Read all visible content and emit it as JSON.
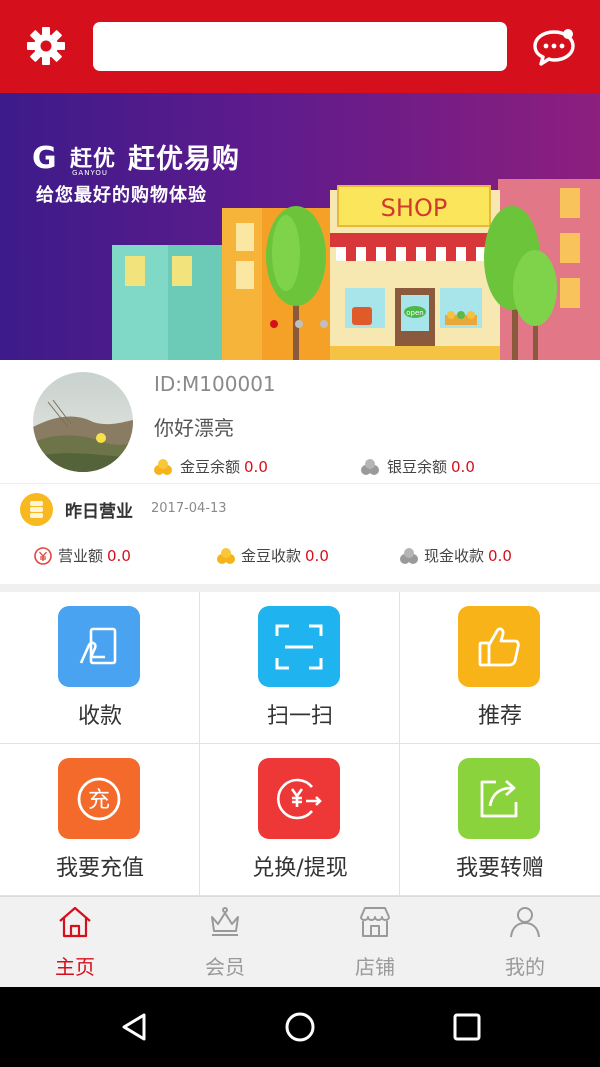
{
  "header": {
    "search_placeholder": "",
    "settings_icon": "gear-icon",
    "message_icon": "chat-bubble-icon"
  },
  "banner": {
    "logo_brand": "赶优",
    "logo_small": "GANYOU",
    "logo_letter": "G",
    "title": "赶优易购",
    "subtitle": "给您最好的购物体验",
    "shop_sign": "SHOP",
    "door_sign": "open",
    "slide_count": 3,
    "active_slide": 1
  },
  "profile": {
    "id_text": "ID:M100001",
    "greeting": "你好漂亮",
    "gold_label": "金豆余额",
    "gold_value": "0.0",
    "silver_label": "银豆余额",
    "silver_value": "0.0"
  },
  "yesterday": {
    "title": "昨日营业",
    "date": "2017-04-13",
    "revenue_label": "营业额",
    "revenue_value": "0.0",
    "gold_income_label": "金豆收款",
    "gold_income_value": "0.0",
    "cash_income_label": "现金收款",
    "cash_income_value": "0.0"
  },
  "grid": [
    {
      "label": "收款",
      "icon": "receive-payment-icon",
      "color": "#4aa3f0"
    },
    {
      "label": "扫一扫",
      "icon": "scan-icon",
      "color": "#1fb3f0"
    },
    {
      "label": "推荐",
      "icon": "thumbs-up-icon",
      "color": "#f8b318"
    },
    {
      "label": "我要充值",
      "icon": "recharge-icon",
      "color": "#f36a2a"
    },
    {
      "label": "兑换/提现",
      "icon": "exchange-withdraw-icon",
      "color": "#ee3838"
    },
    {
      "label": "我要转赠",
      "icon": "share-transfer-icon",
      "color": "#8ad33c"
    }
  ],
  "nav": [
    {
      "label": "主页",
      "icon": "home-icon",
      "active": true
    },
    {
      "label": "会员",
      "icon": "crown-icon",
      "active": false
    },
    {
      "label": "店铺",
      "icon": "store-icon",
      "active": false
    },
    {
      "label": "我的",
      "icon": "user-icon",
      "active": false
    }
  ],
  "colors": {
    "brand_red": "#d5101c",
    "value_red": "#d5101c",
    "nav_inactive": "#9a9a9a"
  }
}
